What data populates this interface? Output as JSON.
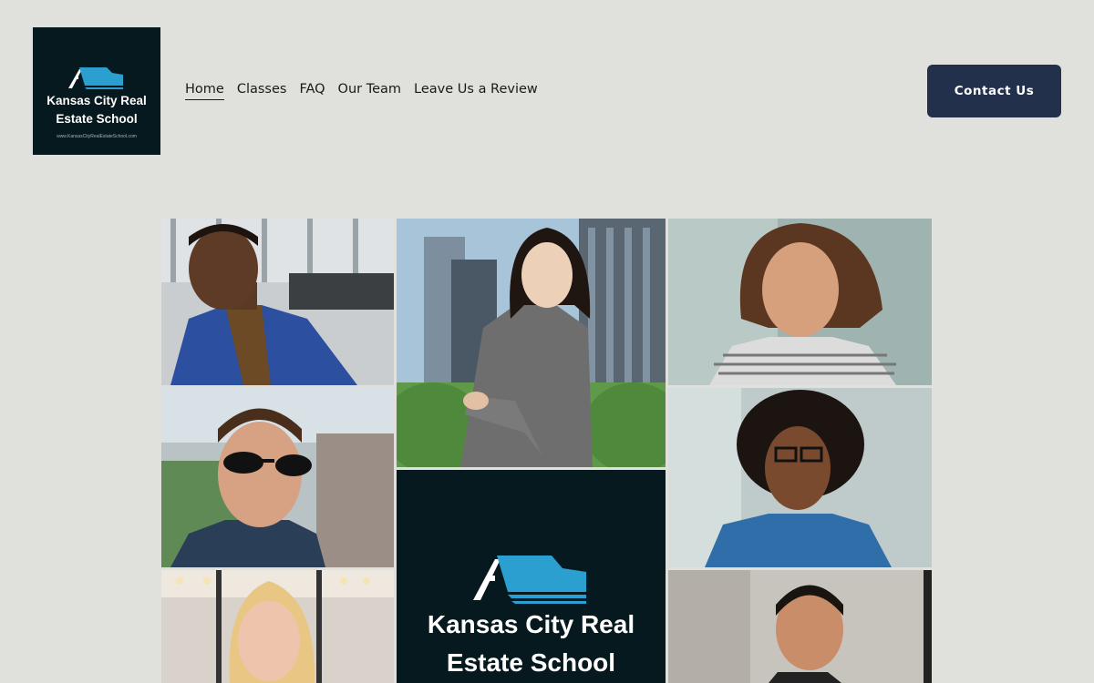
{
  "logo": {
    "line1": "Kansas City Real",
    "line2": "Estate School",
    "url": "www.KansasCityRealEstateSchool.com"
  },
  "nav": {
    "items": [
      {
        "label": "Home",
        "active": true
      },
      {
        "label": "Classes"
      },
      {
        "label": "FAQ"
      },
      {
        "label": "Our Team"
      },
      {
        "label": "Leave Us a Review"
      }
    ]
  },
  "header": {
    "contact_label": "Contact Us"
  },
  "collage": {
    "brand_line1": "Kansas City Real",
    "brand_line2": "Estate School"
  },
  "colors": {
    "background": "#e0e0dc",
    "brand_dark": "#06191f",
    "button": "#23304c",
    "roof_blue": "#2a9fd0"
  }
}
